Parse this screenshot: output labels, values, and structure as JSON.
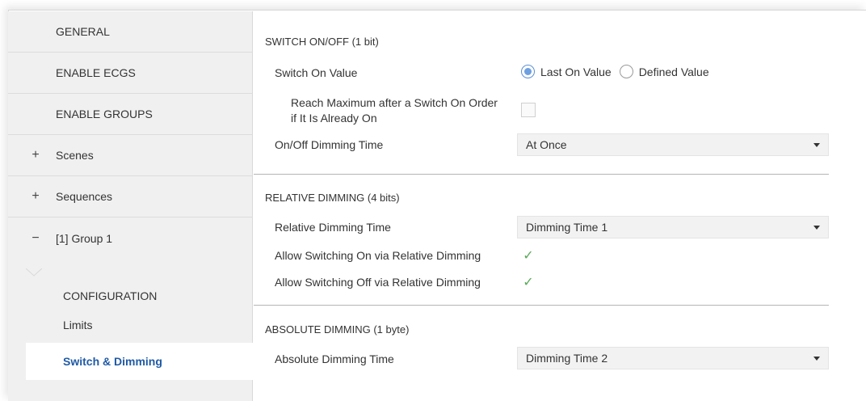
{
  "sidebar": {
    "items": [
      {
        "label": "GENERAL",
        "mark": ""
      },
      {
        "label": "ENABLE ECGS",
        "mark": ""
      },
      {
        "label": "ENABLE GROUPS",
        "mark": ""
      },
      {
        "label": "Scenes",
        "mark": "+"
      },
      {
        "label": "Sequences",
        "mark": "+"
      },
      {
        "label": "[1] Group 1",
        "mark": "−"
      }
    ],
    "subitems": [
      {
        "label": "CONFIGURATION"
      },
      {
        "label": "Limits"
      },
      {
        "label": "Switch & Dimming"
      }
    ]
  },
  "sections": {
    "switch": {
      "title": "SWITCH ON/OFF (1 bit)",
      "switch_on_value_label": "Switch On Value",
      "radio_last": "Last On Value",
      "radio_defined": "Defined Value",
      "reach_max_line1": "Reach Maximum after a Switch On Order",
      "reach_max_line2": "if It Is Already On",
      "onoff_time_label": "On/Off Dimming Time",
      "onoff_time_value": "At Once"
    },
    "relative": {
      "title": "RELATIVE DIMMING (4 bits)",
      "time_label": "Relative Dimming Time",
      "time_value": "Dimming Time 1",
      "allow_on_label": "Allow Switching On via Relative Dimming",
      "allow_off_label": "Allow Switching Off via Relative Dimming"
    },
    "absolute": {
      "title": "ABSOLUTE DIMMING (1 byte)",
      "time_label": "Absolute Dimming Time",
      "time_value": "Dimming Time 2"
    }
  }
}
